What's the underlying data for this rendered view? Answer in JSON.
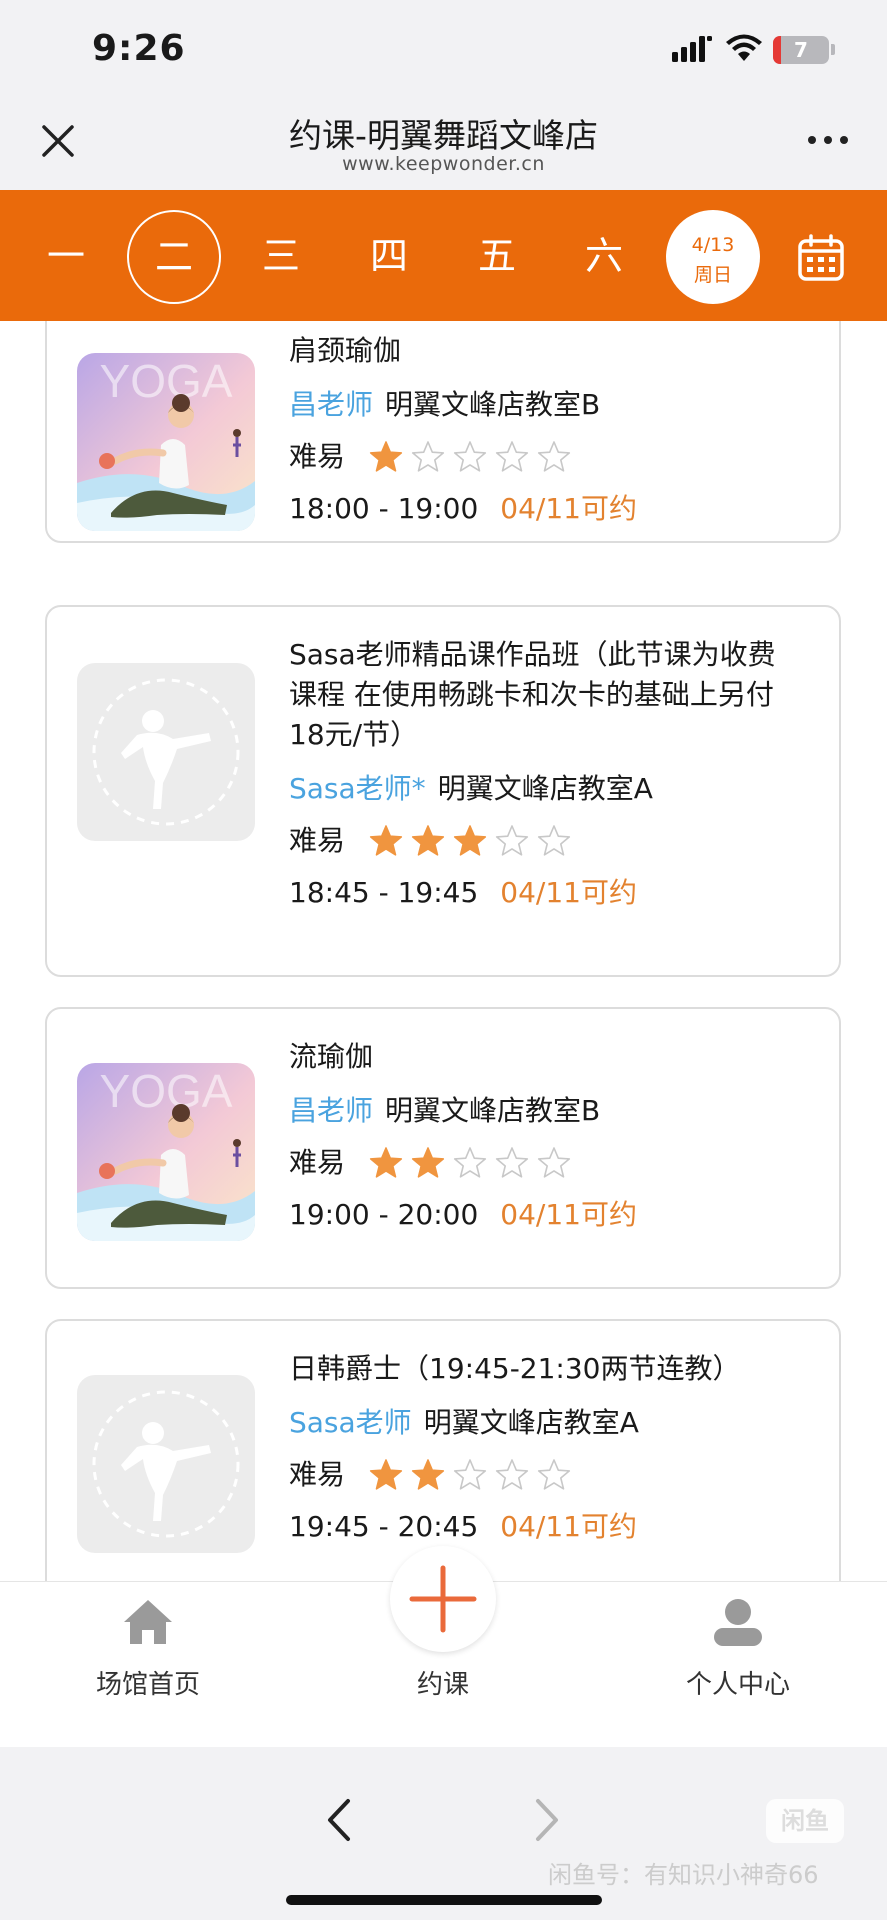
{
  "status_bar": {
    "time": "9:26",
    "battery": "7"
  },
  "nav": {
    "title": "约课-明翼舞蹈文峰店",
    "subtitle": "www.keepwonder.cn"
  },
  "week": {
    "days": [
      "一",
      "二",
      "三",
      "四",
      "五",
      "六"
    ],
    "selected_index": 1,
    "today_date": "4/13",
    "today_label": "周日"
  },
  "colors": {
    "accent": "#ea6a0b",
    "teacher": "#4aa3df",
    "available": "#e3822f",
    "star": "#f0953f"
  },
  "courses": [
    {
      "title": "肩颈瑜伽",
      "teacher": "昌老师",
      "room": "明翼文峰店教室B",
      "difficulty_label": "难易",
      "rating": 1,
      "max_rating": 5,
      "time": "18:00 - 19:00",
      "availability": "04/11可约",
      "thumb": "yoga",
      "thumb_text": "YOGA"
    },
    {
      "title": "Sasa老师精品课作品班（此节课为收费课程 在使用畅跳卡和次卡的基础上另付18元/节）",
      "teacher": "Sasa老师*",
      "room": "明翼文峰店教室A",
      "difficulty_label": "难易",
      "rating": 3,
      "max_rating": 5,
      "time": "18:45 - 19:45",
      "availability": "04/11可约",
      "thumb": "placeholder"
    },
    {
      "title": "流瑜伽",
      "teacher": "昌老师",
      "room": "明翼文峰店教室B",
      "difficulty_label": "难易",
      "rating": 2,
      "max_rating": 5,
      "time": "19:00 - 20:00",
      "availability": "04/11可约",
      "thumb": "yoga",
      "thumb_text": "YOGA"
    },
    {
      "title": "日韩爵士（19:45-21:30两节连教）",
      "teacher": "Sasa老师",
      "room": "明翼文峰店教室A",
      "difficulty_label": "难易",
      "rating": 2,
      "max_rating": 5,
      "time": "19:45 - 20:45",
      "availability": "04/11可约",
      "thumb": "placeholder"
    }
  ],
  "tabbar": {
    "home": "场馆首页",
    "book": "约课",
    "profile": "个人中心"
  },
  "watermark": {
    "logo": "闲鱼",
    "text": "闲鱼号：有知识小神奇66"
  }
}
